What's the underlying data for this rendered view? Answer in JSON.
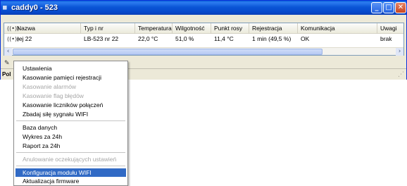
{
  "window": {
    "title": "caddy0 - 523",
    "title_icon": "app-grid-icon",
    "min_glyph": "_",
    "max_glyph": "□",
    "close_glyph": "✕"
  },
  "table": {
    "headers": [
      "Nazwa",
      "Typ i nr",
      "Temperatura",
      "Wilgotność",
      "Punkt rosy",
      "Rejestracja",
      "Komunikacja",
      "Uwagi"
    ],
    "row": {
      "icon": "wifi-signal-icon",
      "nazwa": "rej 22",
      "typ": "LB-523 nr 22",
      "temperatura": "22,0 °C",
      "wilgotnosc": "51,0 %",
      "punkt_rosy": "11,4 °C",
      "rejestracja": "1 min (49,5 %)",
      "komunikacja": "OK",
      "uwagi": "brak"
    },
    "scroll_left": "‹",
    "scroll_right": "›"
  },
  "status": {
    "text": "Pol"
  },
  "menu": {
    "items": [
      {
        "label": "Ustawienia",
        "enabled": true
      },
      {
        "label": "Kasowanie pamięci rejestracji",
        "enabled": true
      },
      {
        "label": "Kasowanie alarmów",
        "enabled": false
      },
      {
        "label": "Kasowanie flag błędów",
        "enabled": false
      },
      {
        "label": "Kasowanie liczników połączeń",
        "enabled": true
      },
      {
        "label": "Zbadaj siłę sygnału WIFI",
        "enabled": true
      },
      {
        "label": "Baza danych",
        "enabled": true
      },
      {
        "label": "Wykres za 24h",
        "enabled": true
      },
      {
        "label": "Raport za 24h",
        "enabled": true
      },
      {
        "label": "Anulowanie oczekujących ustawień",
        "enabled": false
      },
      {
        "label": "Konfiguracja modułu WIFI",
        "enabled": true,
        "selected": true
      },
      {
        "label": "Aktualizacja firmware",
        "enabled": true
      }
    ]
  },
  "colors": {
    "titlebar": "#0b55d6",
    "selection": "#316ac5",
    "disabled_text": "#a6a6a6"
  }
}
